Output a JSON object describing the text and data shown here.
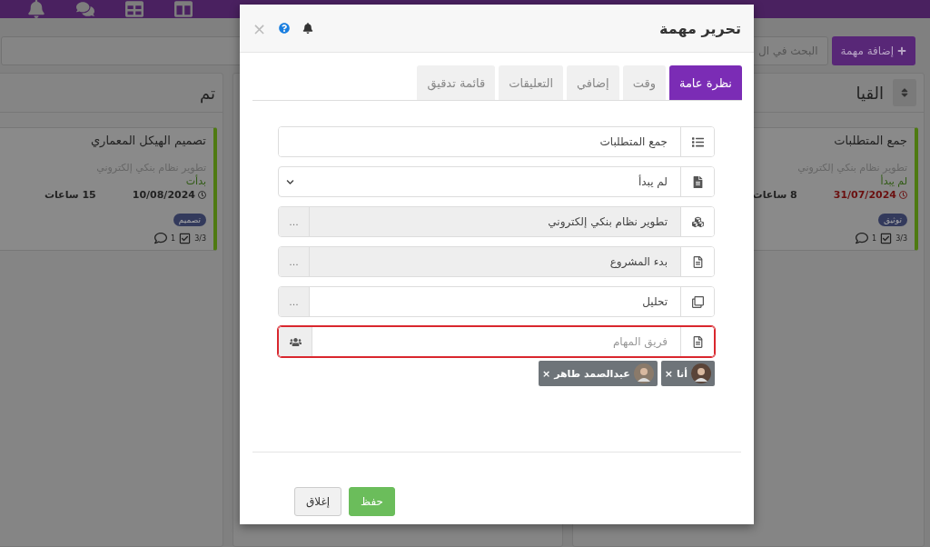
{
  "board": {
    "add_button": "إضافة مهمة",
    "search": {
      "placeholder": "البحث في ال"
    },
    "columns": [
      {
        "title": "القيا",
        "sortable": true,
        "cards": [
          {
            "title": "جمع المتطلبات",
            "project": "تطوير نظام بنكي إلكتروني",
            "status": "لم يبدأ",
            "date": "31/07/2024",
            "overdue": true,
            "hours": "8 ساعات",
            "tag": "توثيق",
            "checklist": "3/3",
            "comments": "1"
          }
        ]
      },
      {
        "title": "تم",
        "sortable": false,
        "cards": [
          {
            "title": "تصميم الهيكل المعماري",
            "project": "تطوير نظام بنكي إلكتروني",
            "status": "بدأت",
            "date": "10/08/2024",
            "overdue": false,
            "hours": "15 ساعات",
            "tag": "تصميم",
            "checklist": "3/3",
            "comments": "1"
          }
        ]
      }
    ]
  },
  "modal": {
    "title": "تحرير مهمة",
    "close": "×",
    "tabs": [
      {
        "label": "نظرة عامة",
        "selected": true
      },
      {
        "label": "وقت",
        "selected": false
      },
      {
        "label": "إضافي",
        "selected": false
      },
      {
        "label": "التعليقات",
        "selected": false
      },
      {
        "label": "قائمة تدقيق",
        "selected": false
      }
    ],
    "fields": [
      {
        "kind": "text",
        "value": "جمع المتطلبات"
      },
      {
        "kind": "select",
        "value": "لم يبدأ"
      },
      {
        "kind": "lookup",
        "value": "تطوير نظام بنكي إلكتروني",
        "disabled": true,
        "more": "..."
      },
      {
        "kind": "lookup",
        "value": "بدء المشروع",
        "disabled": true,
        "more": "..."
      },
      {
        "kind": "lookup",
        "value": "تحليل",
        "disabled": false,
        "more": "..."
      },
      {
        "kind": "team",
        "placeholder": "فريق المهام",
        "invalid": true
      }
    ],
    "members": [
      {
        "name": "أنا",
        "remove": "×"
      },
      {
        "name": "عبدالصمد طاهر",
        "remove": "×"
      }
    ],
    "buttons": [
      {
        "kind": "primary",
        "label": "حفظ"
      },
      {
        "kind": "secondary",
        "label": "إغلاق"
      }
    ]
  }
}
